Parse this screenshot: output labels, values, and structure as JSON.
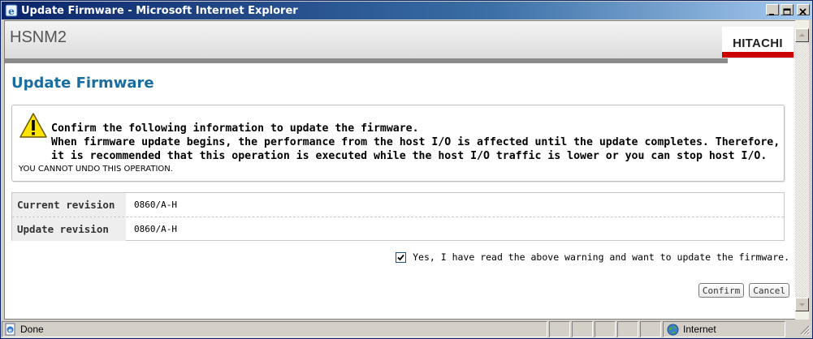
{
  "window": {
    "title": "Update Firmware - Microsoft Internet Explorer",
    "icons": [
      "ie-app-icon",
      "minimize-icon",
      "maximize-icon",
      "close-icon"
    ]
  },
  "header": {
    "app_name": "HSNM2",
    "brand": "HITACHI",
    "brand_color": "#cc0000"
  },
  "page": {
    "title": "Update Firmware",
    "title_color": "#1a6d9f"
  },
  "warning": {
    "icon": "warning-icon",
    "lines": [
      "Confirm the following information to update the firmware.",
      "When firmware update begins, the performance from the host I/O is affected until the update completes. Therefore,",
      "it is recommended that this operation is executed while the host I/O traffic is lower or you can stop host I/O."
    ],
    "undo_notice": "YOU CANNOT UNDO THIS OPERATION."
  },
  "revisions": {
    "rows": [
      {
        "label": "Current revision",
        "value": "0860/A-H"
      },
      {
        "label": "Update revision",
        "value": "0860/A-H"
      }
    ]
  },
  "confirmation": {
    "checked": true,
    "label": "Yes, I have read the above warning and want to update the firmware."
  },
  "buttons": {
    "confirm": "Confirm",
    "cancel": "Cancel"
  },
  "statusbar": {
    "status": "Done",
    "zone": "Internet"
  }
}
